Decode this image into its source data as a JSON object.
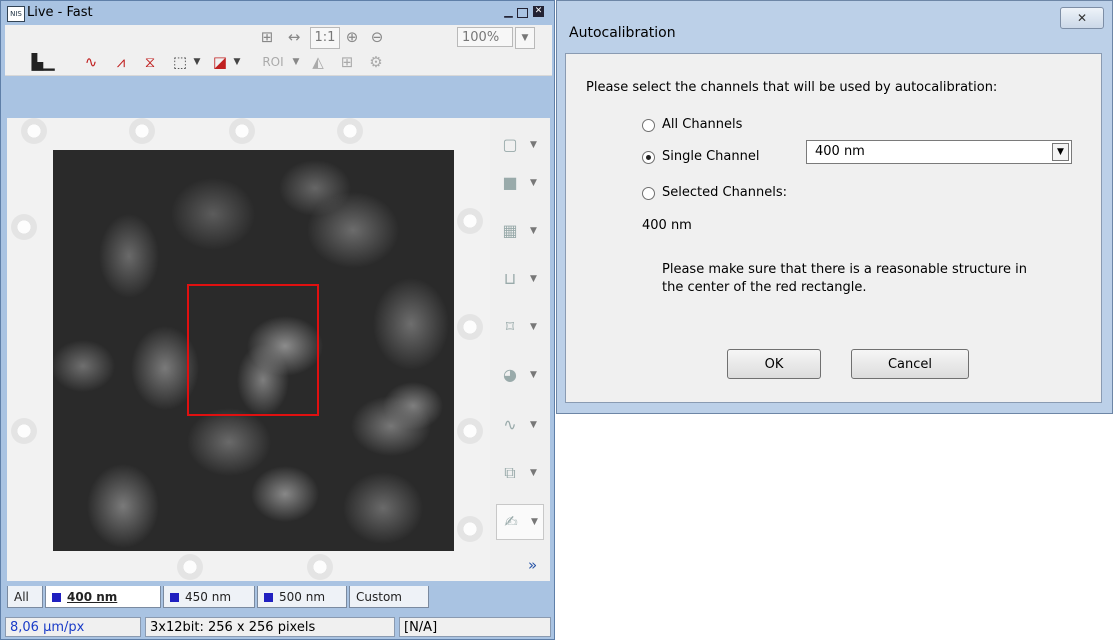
{
  "live_window": {
    "title": "Live - Fast",
    "toolbar": {
      "ratio_label": "1:1",
      "zoom_value": "100%"
    },
    "tabs": [
      {
        "label": "All",
        "has_swatch": false
      },
      {
        "label": "400 nm",
        "has_swatch": true,
        "active": true
      },
      {
        "label": "450 nm",
        "has_swatch": true
      },
      {
        "label": "500 nm",
        "has_swatch": true
      },
      {
        "label": "Custom",
        "has_swatch": false
      }
    ],
    "status": {
      "scale": "8,06 µm/px",
      "format": "3x12bit: 256 x 256 pixels",
      "extra": "[N/A]"
    },
    "more_glyph": "»"
  },
  "dialog": {
    "title": "Autocalibration",
    "instruction": "Please select the channels that will be used by autocalibration:",
    "options": {
      "all_channels": "All Channels",
      "single_channel": "Single Channel",
      "selected_channels": "Selected Channels:"
    },
    "selected_option": "single_channel",
    "channel_select_value": "400 nm",
    "selected_channels_value": "400 nm",
    "note_line1": "Please make sure that there is a reasonable structure in",
    "note_line2": "the center of the red rectangle.",
    "ok_label": "OK",
    "cancel_label": "Cancel"
  },
  "colors": {
    "roi": "#e01010",
    "channel_swatch": "#2020c0",
    "status_scale": "#1a3cc8"
  }
}
